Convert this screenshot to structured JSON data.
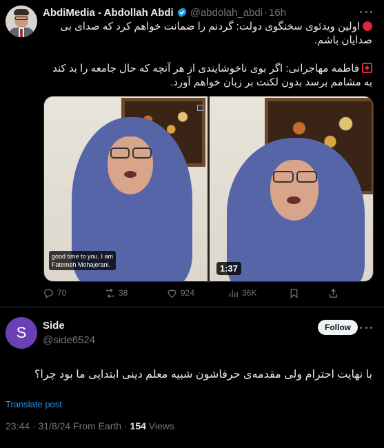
{
  "quoted_tweet": {
    "author_name": "AbdiMedia - Abdollah Abdi",
    "handle": "@abdolah_abdi",
    "separator": "·",
    "time": "16h",
    "text_line1": "اولین ویدئوی سخنگوی دولت: گردنم را ضمانت خواهم کرد که صدای بی صدایان باشم.",
    "text_line2": "فاطمه مهاجرانی: اگر بوی ناخوشایندی از هر آنچه که حال جامعه را بد کند به مشامم برسد بدون لکنت بر زبان خواهم آورد.",
    "video_caption_line1": "good time to you. I am",
    "video_caption_line2": "Fatemeh Mohajerani.",
    "video_duration": "1:37",
    "actions": {
      "replies": "70",
      "reposts": "38",
      "likes": "924",
      "views": "36K"
    }
  },
  "reply": {
    "avatar_letter": "S",
    "author_name": "Side",
    "handle": "@side6524",
    "follow_label": "Follow",
    "text": "با نهایت احترام ولی مقدمه‌ی حرفاشون شبیه معلم دینی ابتدایی ما بود چرا؟",
    "translate_label": "Translate post",
    "timestamp": "23:44 · 31/8/24 From Earth ·",
    "views_count": "154",
    "views_label": "Views"
  },
  "colors": {
    "background": "#000000",
    "text": "#e7e9ea",
    "muted": "#71767b",
    "link": "#1d9bf0",
    "verified": "#1d9bf0",
    "reply_avatar": "#6b3fb5"
  }
}
